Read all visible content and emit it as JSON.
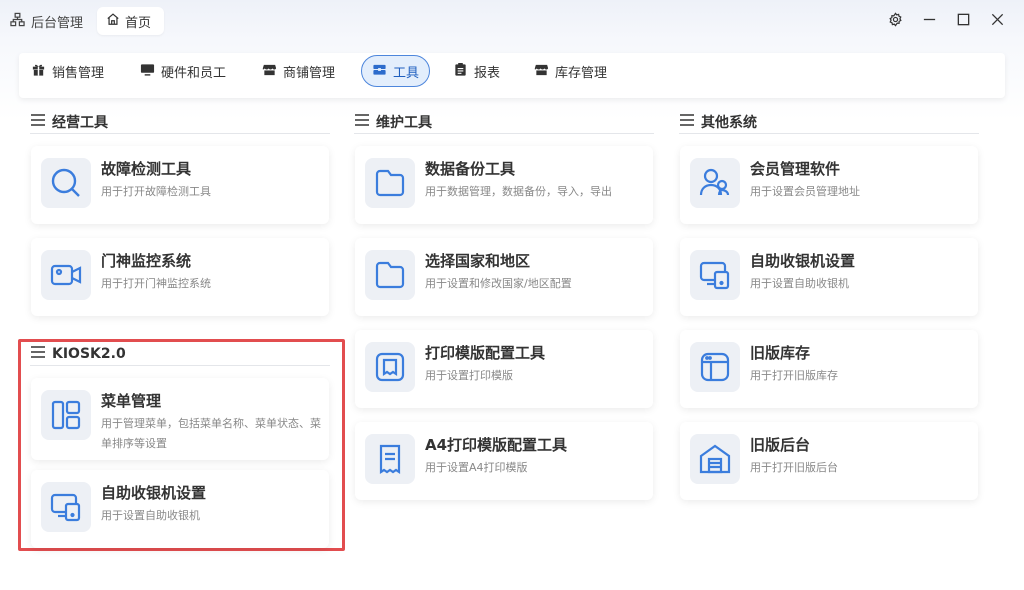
{
  "titlebar": {
    "app_title": "后台管理",
    "home_tab": "首页"
  },
  "categories": [
    {
      "label": "销售管理",
      "icon": "gift-icon",
      "active": false
    },
    {
      "label": "硬件和员工",
      "icon": "monitor-icon",
      "active": false
    },
    {
      "label": "商铺管理",
      "icon": "store-icon",
      "active": false
    },
    {
      "label": "工具",
      "icon": "toolbox-icon",
      "active": true
    },
    {
      "label": "报表",
      "icon": "clipboard-icon",
      "active": false
    },
    {
      "label": "库存管理",
      "icon": "store-icon",
      "active": false
    }
  ],
  "sections": {
    "business": {
      "title": "经营工具",
      "cards": [
        {
          "title": "故障检测工具",
          "desc": "用于打开故障检测工具",
          "icon": "search-icon"
        },
        {
          "title": "门神监控系统",
          "desc": "用于打开门神监控系统",
          "icon": "video-camera-icon"
        }
      ]
    },
    "kiosk": {
      "title": "KIOSK2.0",
      "cards": [
        {
          "title": "菜单管理",
          "desc": "用于管理菜单，包括菜单名称、菜单状态、菜单排序等设置",
          "icon": "layout-icon"
        },
        {
          "title": "自助收银机设置",
          "desc": "用于设置自助收银机",
          "icon": "self-checkout-icon"
        }
      ]
    },
    "maintenance": {
      "title": "维护工具",
      "cards": [
        {
          "title": "数据备份工具",
          "desc": "用于数据管理，数据备份，导入，导出",
          "icon": "folder-icon"
        },
        {
          "title": "选择国家和地区",
          "desc": "用于设置和修改国家/地区配置",
          "icon": "folder-icon"
        },
        {
          "title": "打印模版配置工具",
          "desc": "用于设置打印模版",
          "icon": "print-template-icon"
        },
        {
          "title": "A4打印模版配置工具",
          "desc": "用于设置A4打印模版",
          "icon": "receipt-icon"
        }
      ]
    },
    "other": {
      "title": "其他系统",
      "cards": [
        {
          "title": "会员管理软件",
          "desc": "用于设置会员管理地址",
          "icon": "users-icon"
        },
        {
          "title": "自助收银机设置",
          "desc": "用于设置自助收银机",
          "icon": "self-checkout-icon"
        },
        {
          "title": "旧版库存",
          "desc": "用于打开旧版库存",
          "icon": "window-icon"
        },
        {
          "title": "旧版后台",
          "desc": "用于打开旧版后台",
          "icon": "warehouse-icon"
        }
      ]
    }
  },
  "colors": {
    "accent": "#4d86dc",
    "icon_blue": "#3b7ddd",
    "highlight": "#e24d4f"
  }
}
